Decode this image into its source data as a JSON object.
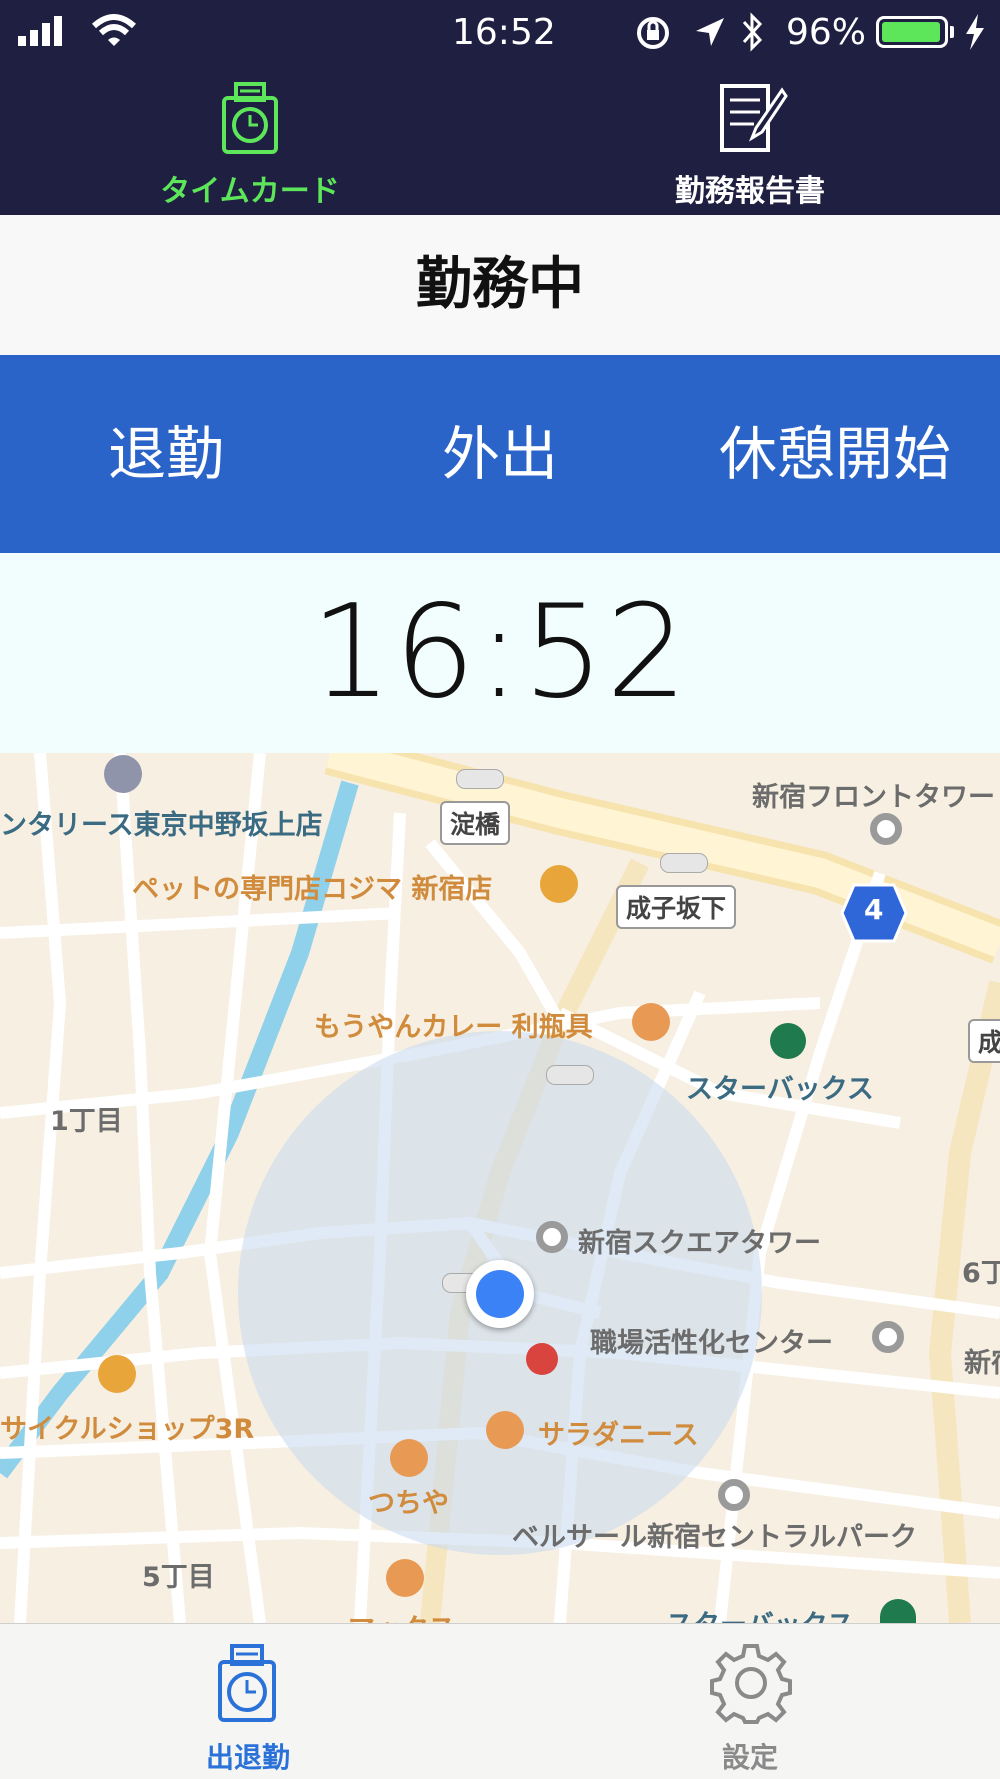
{
  "status_bar": {
    "time": "16:52",
    "battery_percent": "96%",
    "battery_level": 0.96,
    "icons": [
      "signal-icon",
      "wifi-icon",
      "orientation-lock-icon",
      "location-icon",
      "bluetooth-icon",
      "battery-icon",
      "charging-icon"
    ]
  },
  "top_tabs": [
    {
      "label": "タイムカード",
      "icon": "timecard-icon",
      "active": true
    },
    {
      "label": "勤務報告書",
      "icon": "report-icon",
      "active": false
    }
  ],
  "work_status": "勤務中",
  "actions": [
    {
      "label": "退勤"
    },
    {
      "label": "外出"
    },
    {
      "label": "休憩開始"
    }
  ],
  "clock": "16:52",
  "map": {
    "labels": {
      "rental": "ンタリース東京中野坂上店",
      "yodobashi": "淀橋",
      "shinjuku_front": "新宿フロントタワー",
      "pet_shop": "ペットの専門店コジマ 新宿店",
      "narikozaka": "成子坂下",
      "route": "4",
      "curry": "もうやんカレー 利瓶具",
      "starbucks1": "スターバックス",
      "chome1": "1丁目",
      "square_tower": "新宿スクエアタワー",
      "center": "職場活性化センター",
      "cycle_shop": "サイクルショップ3R",
      "salad": "サラダニース",
      "tsuchiya": "つちや",
      "bellesalle": "ベルサール新宿セントラルパーク",
      "chome5": "5丁目",
      "starbucks2": "スターバックス",
      "makkusu": "マックス",
      "chome6": "6丁",
      "shinjuku_edge": "新宿",
      "naru_edge": "成"
    }
  },
  "bottom_tabs": [
    {
      "label": "出退勤",
      "icon": "clock-icon",
      "active": true
    },
    {
      "label": "設定",
      "icon": "gear-icon",
      "active": false
    }
  ],
  "colors": {
    "header_bg": "#1f1f42",
    "accent_green": "#5ee65a",
    "action_blue": "#2a64c9",
    "tab_active_blue": "#2a72d8",
    "tab_inactive_gray": "#8a8a8a",
    "location_blue": "#3b82f6"
  }
}
